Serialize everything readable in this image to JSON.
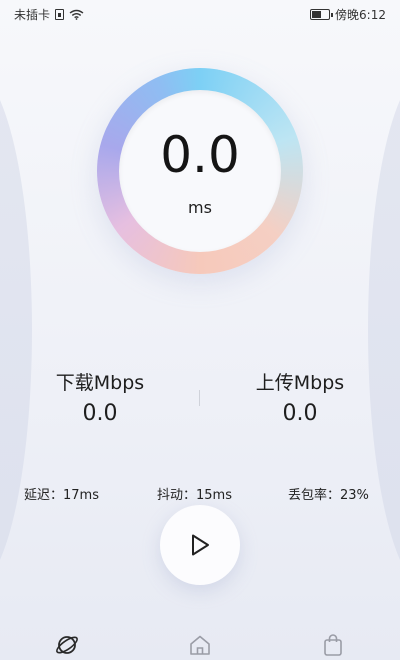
{
  "status_bar": {
    "carrier": "未插卡",
    "time": "傍晚6:12",
    "battery_level": 0.55
  },
  "gauge": {
    "value": "0.0",
    "unit": "ms"
  },
  "download": {
    "label": "下载Mbps",
    "value": "0.0"
  },
  "upload": {
    "label": "上传Mbps",
    "value": "0.0"
  },
  "stats": {
    "delay": "延迟：17ms",
    "jitter": "抖动：15ms",
    "loss": "丢包率：23%"
  },
  "icons": {
    "play": "play-icon",
    "nav": [
      "planet-icon",
      "home-icon",
      "bag-icon"
    ]
  }
}
